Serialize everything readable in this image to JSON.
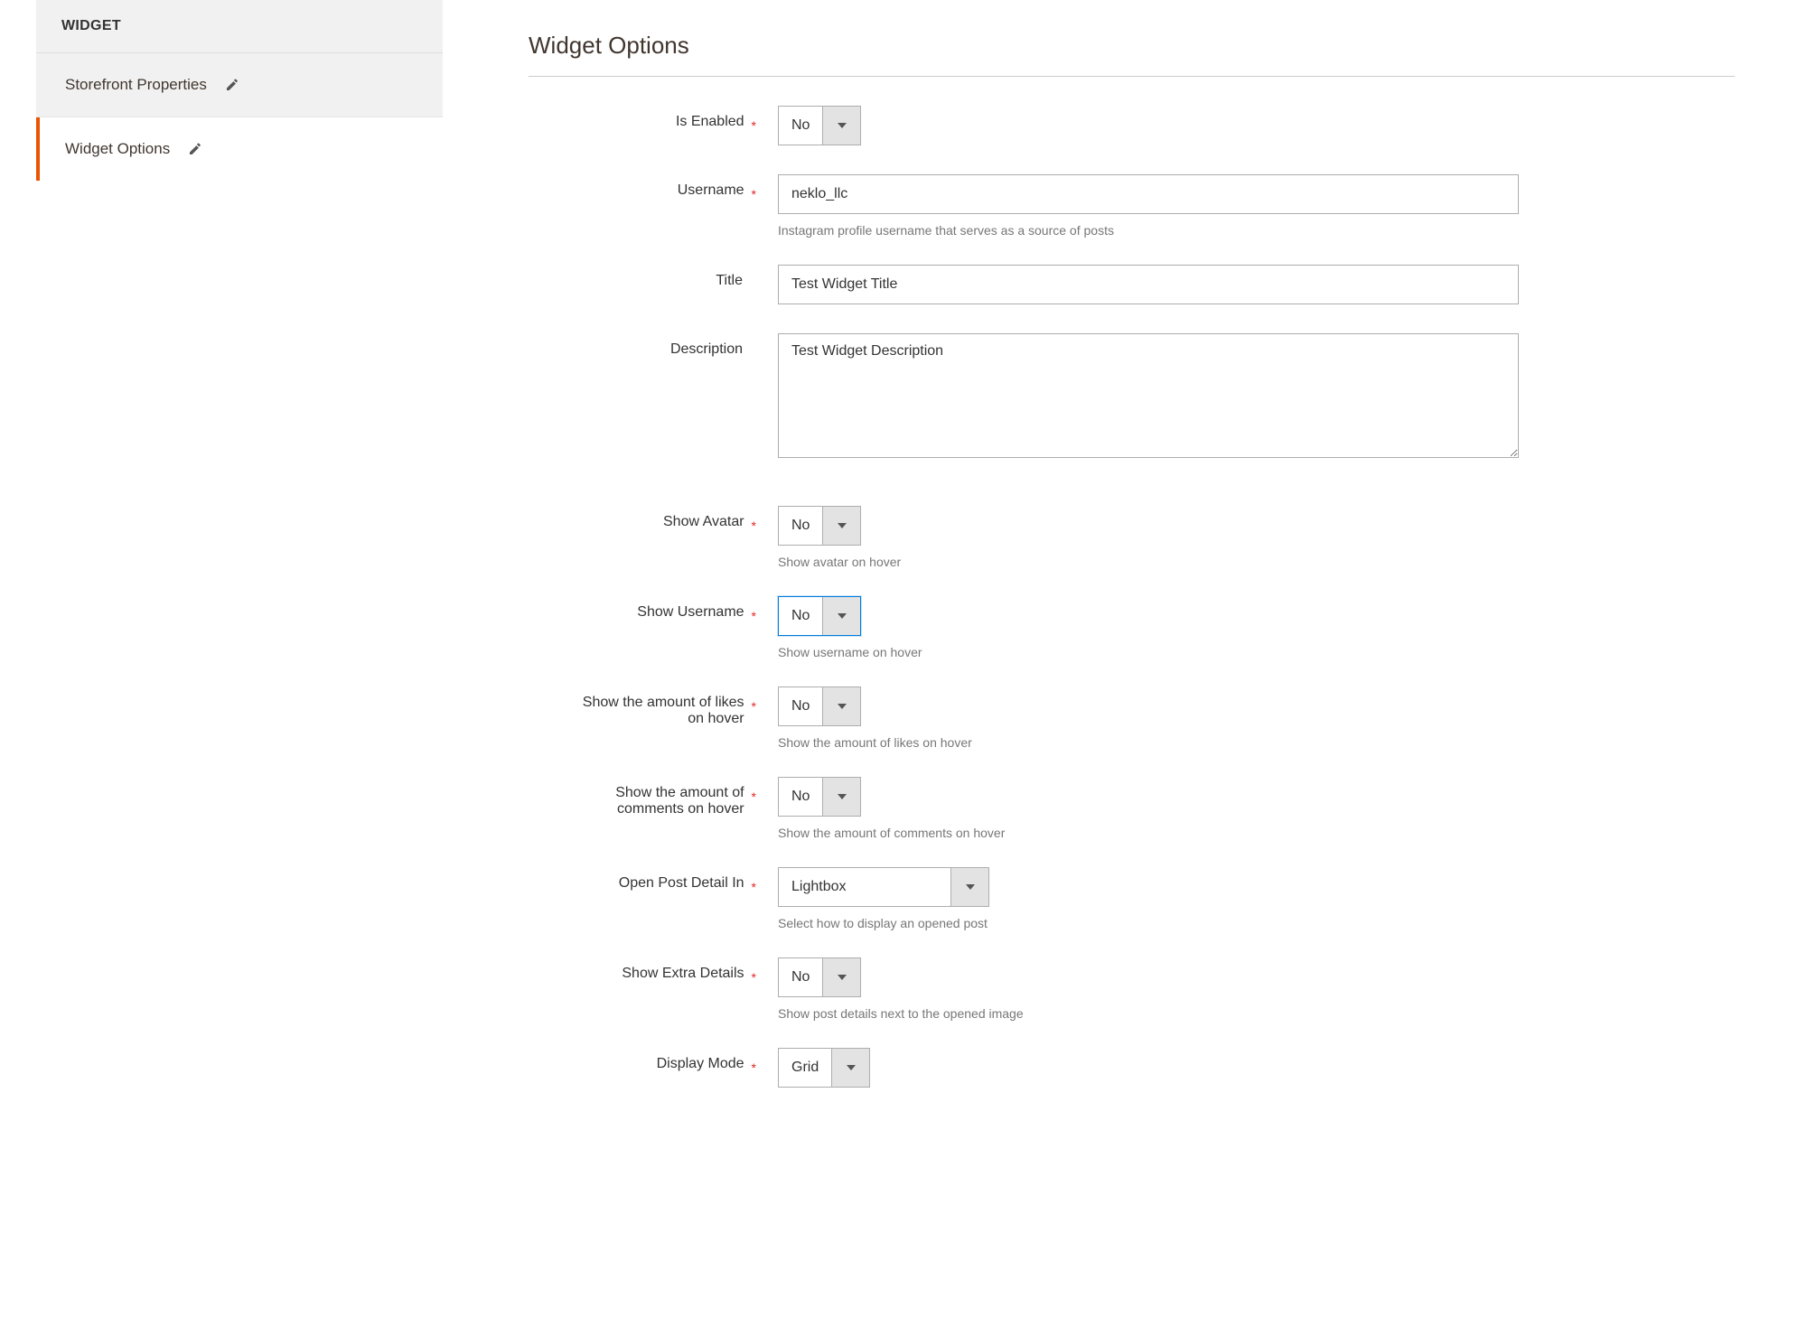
{
  "sidebar": {
    "header": "WIDGET",
    "items": [
      {
        "label": "Storefront Properties"
      },
      {
        "label": "Widget Options"
      }
    ]
  },
  "page": {
    "title": "Widget Options"
  },
  "fields": {
    "is_enabled": {
      "label": "Is Enabled",
      "value": "No"
    },
    "username": {
      "label": "Username",
      "value": "neklo_llc",
      "hint": "Instagram profile username that serves as a source of posts"
    },
    "title": {
      "label": "Title",
      "value": "Test Widget Title"
    },
    "description": {
      "label": "Description",
      "value": "Test Widget Description"
    },
    "show_avatar": {
      "label": "Show Avatar",
      "value": "No",
      "hint": "Show avatar on hover"
    },
    "show_username": {
      "label": "Show Username",
      "value": "No",
      "hint": "Show username on hover"
    },
    "show_likes": {
      "label": "Show the amount of likes on hover",
      "value": "No",
      "hint": "Show the amount of likes on hover"
    },
    "show_comments": {
      "label": "Show the amount of comments on hover",
      "value": "No",
      "hint": "Show the amount of comments on hover"
    },
    "open_post": {
      "label": "Open Post Detail In",
      "value": "Lightbox",
      "hint": "Select how to display an opened post"
    },
    "extra_details": {
      "label": "Show Extra Details",
      "value": "No",
      "hint": "Show post details next to the opened image"
    },
    "display_mode": {
      "label": "Display Mode",
      "value": "Grid"
    }
  }
}
